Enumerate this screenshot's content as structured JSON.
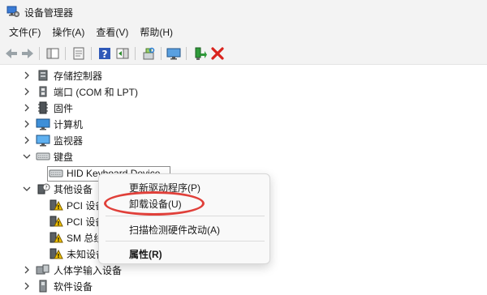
{
  "window": {
    "title": "设备管理器"
  },
  "menubar": {
    "items": [
      "文件(F)",
      "操作(A)",
      "查看(V)",
      "帮助(H)"
    ]
  },
  "tree": {
    "items": [
      {
        "label": "存储控制器",
        "icon": "storage-controller-icon"
      },
      {
        "label": "端口 (COM 和 LPT)",
        "icon": "port-icon"
      },
      {
        "label": "固件",
        "icon": "firmware-icon"
      },
      {
        "label": "计算机",
        "icon": "computer-icon"
      },
      {
        "label": "监视器",
        "icon": "monitor-icon"
      },
      {
        "label": "键盘",
        "icon": "keyboard-icon",
        "children": [
          {
            "label": "HID Keyboard Device",
            "icon": "keyboard-icon"
          }
        ]
      },
      {
        "label": "其他设备",
        "icon": "unknown-device-icon",
        "children": [
          {
            "label": "PCI 设备",
            "icon": "warning-device-icon"
          },
          {
            "label": "PCI 设备",
            "icon": "warning-device-icon"
          },
          {
            "label": "SM 总线控制器",
            "icon": "warning-device-icon"
          },
          {
            "label": "未知设备",
            "icon": "warning-device-icon"
          }
        ]
      },
      {
        "label": "人体学输入设备",
        "icon": "hid-icon"
      },
      {
        "label": "软件设备",
        "icon": "software-device-icon"
      }
    ]
  },
  "context_menu": {
    "items": [
      "更新驱动程序(P)",
      "卸载设备(U)",
      "扫描检测硬件改动(A)",
      "属性(R)"
    ]
  },
  "colors": {
    "highlight_oval": "#e0403a",
    "warning": "#f2c300"
  }
}
